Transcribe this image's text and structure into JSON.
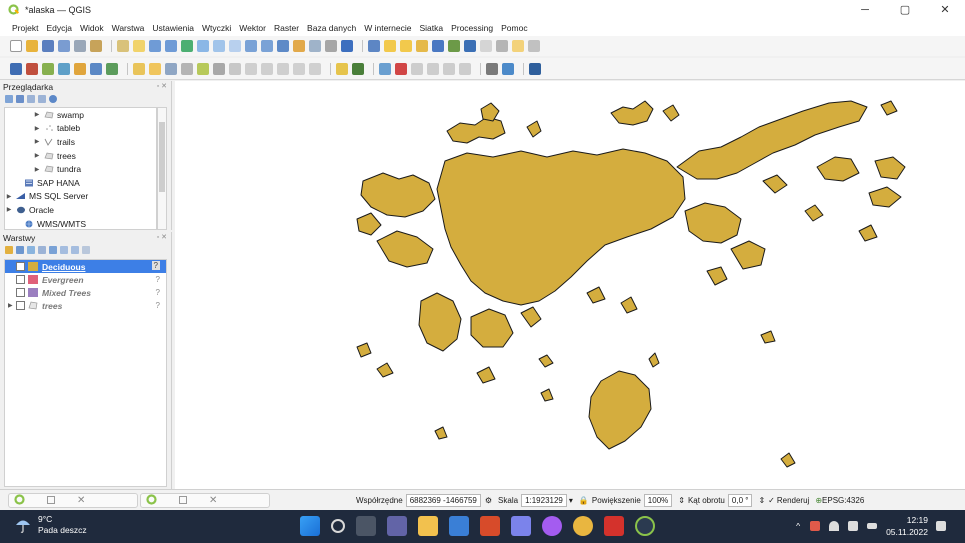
{
  "window": {
    "title": "*alaska — QGIS",
    "controls": {
      "minimize": "─",
      "maximize": "▢",
      "close": "✕"
    }
  },
  "menu": [
    "Projekt",
    "Edycja",
    "Widok",
    "Warstwa",
    "Ustawienia",
    "Wtyczki",
    "Wektor",
    "Raster",
    "Baza danych",
    "W internecie",
    "Siatka",
    "Processing",
    "Pomoc"
  ],
  "browser_panel": {
    "title": "Przeglądarka",
    "items": [
      {
        "label": "swamp",
        "icon": "polygon-layer-icon",
        "level": 2
      },
      {
        "label": "tableb",
        "icon": "table-icon",
        "level": 2
      },
      {
        "label": "trails",
        "icon": "line-layer-icon",
        "level": 2
      },
      {
        "label": "trees",
        "icon": "polygon-layer-icon",
        "level": 2
      },
      {
        "label": "tundra",
        "icon": "polygon-layer-icon",
        "level": 2
      },
      {
        "label": "SAP HANA",
        "icon": "database-icon",
        "level": 0
      },
      {
        "label": "MS SQL Server",
        "icon": "database-icon",
        "level": 0
      },
      {
        "label": "Oracle",
        "icon": "database-icon",
        "level": 0
      },
      {
        "label": "WMS/WMTS",
        "icon": "globe-icon",
        "level": 0
      }
    ]
  },
  "layers_panel": {
    "title": "Warstwy",
    "layers": [
      {
        "label": "Deciduous",
        "checked": true,
        "color": "#d4ad3e",
        "selected": true
      },
      {
        "label": "Evergreen",
        "checked": false,
        "color": "#e0617a",
        "selected": false
      },
      {
        "label": "Mixed Trees",
        "checked": false,
        "color": "#9b7fc0",
        "selected": false
      },
      {
        "label": "trees",
        "checked": false,
        "color": "#ffffff",
        "selected": false,
        "group": true
      }
    ]
  },
  "map": {
    "fill_color": "#d4ad3e",
    "stroke_color": "#1a1a1a",
    "background": "#ffffff"
  },
  "status": {
    "coords_label": "Współrzędne",
    "coords_value": "6882369 -1466759",
    "scale_label": "Skala",
    "scale_value": "1:1923129",
    "magnifier_label": "Powiększenie",
    "magnifier_value": "100%",
    "rotation_label": "Kąt obrotu",
    "rotation_value": "0,0 °",
    "render_label": "Renderuj",
    "crs": "EPSG:4326"
  },
  "taskbar": {
    "temperature": "9°C",
    "weather": "Pada deszcz",
    "time": "12:19",
    "date": "05.11.2022"
  }
}
